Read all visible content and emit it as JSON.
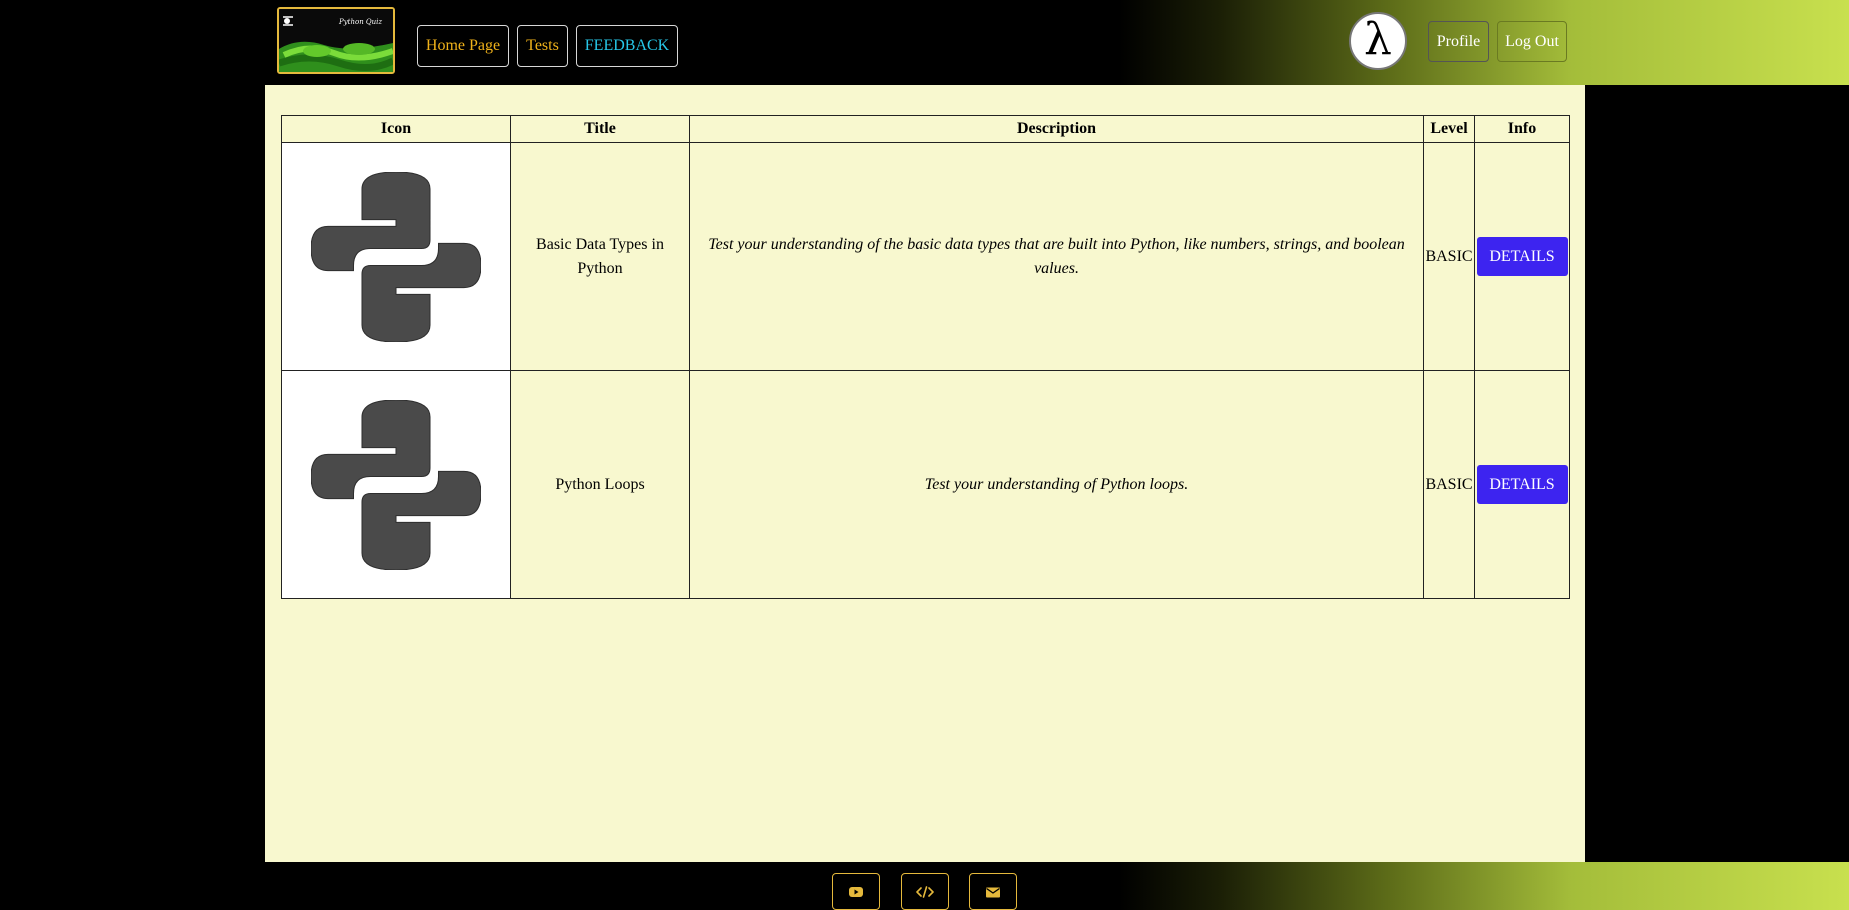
{
  "header": {
    "logo_text": "Python Quiz",
    "nav": {
      "home": "Home Page",
      "tests": "Tests",
      "feedback": "FEEDBACK"
    },
    "avatar_glyph": "λ",
    "profile": "Profile",
    "logout": "Log Out"
  },
  "table": {
    "headers": {
      "icon": "Icon",
      "title": "Title",
      "description": "Description",
      "level": "Level",
      "info": "Info"
    },
    "rows": [
      {
        "icon": "python-logo-icon",
        "title": "Basic Data Types in Python",
        "description": "Test your understanding of the basic data types that are built into Python, like numbers, strings, and boolean values.",
        "level": "BASIC",
        "action": "DETAILS"
      },
      {
        "icon": "python-logo-icon",
        "title": "Python Loops",
        "description": "Test your understanding of Python loops.",
        "level": "BASIC",
        "action": "DETAILS"
      }
    ]
  },
  "footer": {
    "icons": [
      "youtube-icon",
      "code-icon",
      "envelope-icon"
    ]
  },
  "colors": {
    "nav_text": "#f0b21a",
    "feedback_text": "#27c7e8",
    "details_button": "#3d24f0",
    "main_background": "#f8f8cf",
    "accent_border": "#e5b93c"
  }
}
